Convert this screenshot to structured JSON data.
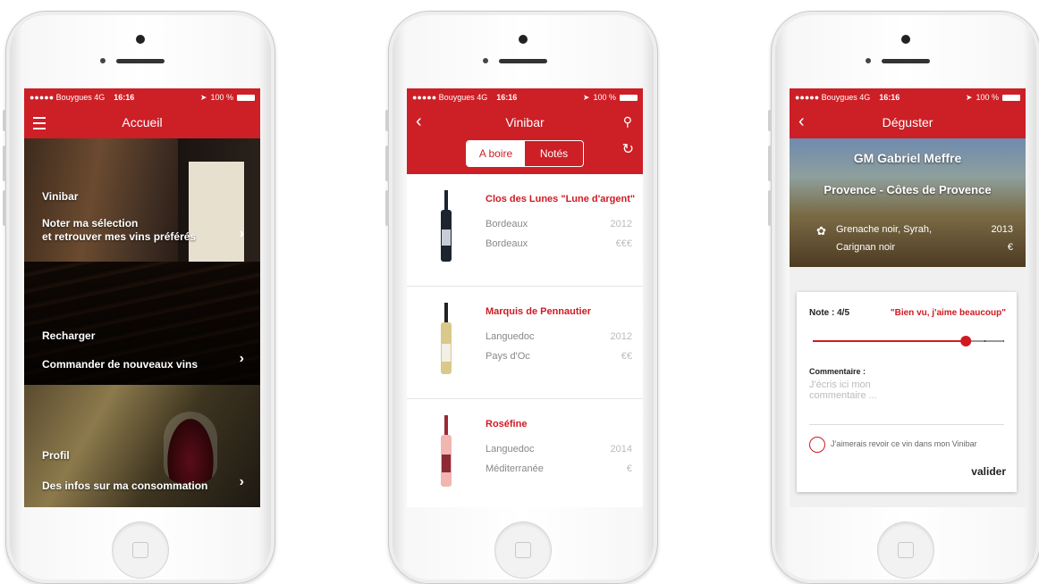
{
  "status": {
    "carrier": "●●●●● Bouygues  4G",
    "time": "16:16",
    "battery": "100 %"
  },
  "screen1": {
    "nav_title": "Accueil",
    "tiles": [
      {
        "title": "Vinibar",
        "sub1": "Noter ma sélection",
        "sub2": "et retrouver mes vins préférés"
      },
      {
        "title": "Recharger",
        "sub1": "Commander de nouveaux vins",
        "sub2": ""
      },
      {
        "title": "Profil",
        "sub1": "Des infos sur ma consommation",
        "sub2": ""
      }
    ]
  },
  "screen2": {
    "nav_title": "Vinibar",
    "seg_on": "A boire",
    "seg_off": "Notés",
    "wines": [
      {
        "name": "Clos des Lunes \"Lune d'argent\"",
        "region": "Bordeaux",
        "appellation": "Bordeaux",
        "year": "2012",
        "price": "€€€"
      },
      {
        "name": "Marquis de Pennautier",
        "region": "Languedoc",
        "appellation": "Pays d'Oc",
        "year": "2012",
        "price": "€€"
      },
      {
        "name": "Roséfine",
        "region": "Languedoc",
        "appellation": "Méditerranée",
        "year": "2014",
        "price": "€"
      }
    ]
  },
  "screen3": {
    "nav_title": "Déguster",
    "producer": "GM Gabriel Meffre",
    "region": "Provence - Côtes de Provence",
    "grapes1": "Grenache noir, Syrah,",
    "grapes2": "Carignan noir",
    "year": "2013",
    "price": "€",
    "note_label": "Note : 4/5",
    "note_quote": "\"Bien vu, j'aime beaucoup\"",
    "rating": 4,
    "rating_max": 5,
    "comment_label": "Commentaire :",
    "comment_placeholder": "J'écris ici mon commentaire ...",
    "checkbox_label": "J'aimerais revoir ce vin dans mon Vinibar",
    "submit_label": "valider"
  },
  "colors": {
    "accent": "#cc1f26",
    "wine_name": "#d01a22"
  }
}
